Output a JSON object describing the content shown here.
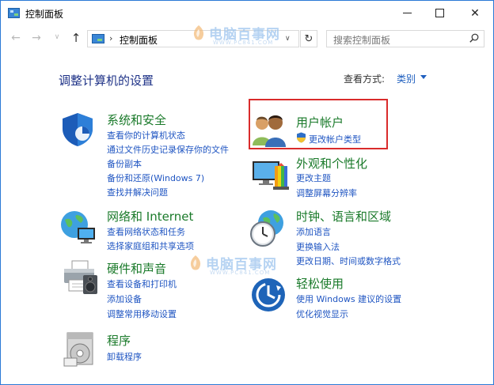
{
  "window": {
    "title": "控制面板",
    "minimize_glyph": "—",
    "maximize_glyph": "☐",
    "close_glyph": "✕"
  },
  "navigation": {
    "back_glyph": "←",
    "forward_glyph": "→",
    "dropdown_glyph": "∨",
    "up_glyph": "↑",
    "address_separator": "›",
    "address_text": "控制面板",
    "address_dropdown_glyph": "∨",
    "refresh_glyph": "↻",
    "search_placeholder": "搜索控制面板"
  },
  "header": {
    "page_title": "调整计算机的设置",
    "view_label": "查看方式:",
    "view_value": "类别"
  },
  "categories": {
    "system_security": {
      "heading": "系统和安全",
      "links": [
        "查看你的计算机状态",
        "通过文件历史记录保存你的文件",
        "备份副本",
        "备份和还原(Windows 7)",
        "查找并解决问题"
      ]
    },
    "network": {
      "heading": "网络和 Internet",
      "links": [
        "查看网络状态和任务",
        "选择家庭组和共享选项"
      ]
    },
    "hardware": {
      "heading": "硬件和声音",
      "links": [
        "查看设备和打印机",
        "添加设备",
        "调整常用移动设置"
      ]
    },
    "programs": {
      "heading": "程序",
      "links": [
        "卸载程序"
      ]
    },
    "user_accounts": {
      "heading": "用户帐户",
      "links": [
        "更改帐户类型"
      ]
    },
    "appearance": {
      "heading": "外观和个性化",
      "links": [
        "更改主题",
        "调整屏幕分辨率"
      ]
    },
    "clock_region": {
      "heading": "时钟、语言和区域",
      "links": [
        "添加语言",
        "更换输入法",
        "更改日期、时间或数字格式"
      ]
    },
    "ease_of_access": {
      "heading": "轻松使用",
      "links": [
        "使用 Windows 建议的设置",
        "优化视觉显示"
      ]
    }
  },
  "watermark": {
    "text": "电脑百事网",
    "subtext": "WWW.PC841.COM"
  },
  "colors": {
    "window_border": "#2b79d6",
    "heading_green": "#1a7a2a",
    "link_blue": "#1f55c2",
    "title_navy": "#1e3287",
    "highlight_red": "#d92b2b"
  }
}
